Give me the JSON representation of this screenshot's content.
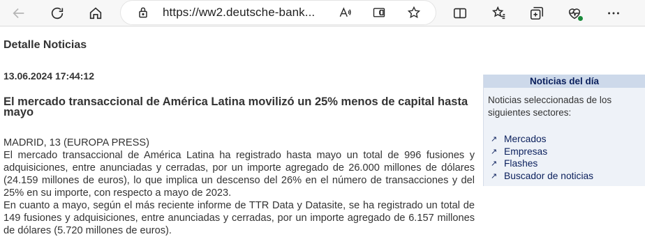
{
  "browser": {
    "url": "https://ww2.deutsche-bank..."
  },
  "page": {
    "heading": "Detalle Noticias",
    "timestamp": "13.06.2024 17:44:12",
    "headline": "El mercado transaccional de América Latina movilizó un 25% menos de capital hasta mayo",
    "dateline": "MADRID, 13 (EUROPA PRESS)",
    "paragraphs": [
      "El mercado transaccional de América Latina ha registrado hasta mayo un total de 996 fusiones y adquisiciones, entre anunciadas y cerradas, por un importe agregado de 26.000 millones de dólares (24.159 millones de euros), lo que implica un descenso del 26% en el número de transacciones y del 25% en su importe, con respecto a mayo de 2023.",
      "En cuanto a mayo, según el más reciente informe de TTR Data y Datasite, se ha registrado un total de 149 fusiones y adquisiciones, entre anunciadas y cerradas, por un importe agregado de 6.157 millones de dólares (5.720 millones de euros)."
    ]
  },
  "sidebar": {
    "title": "Noticias del día",
    "description": "Noticias seleccionadas de los siguientes sectores:",
    "links": [
      "Mercados",
      "Empresas",
      "Flashes",
      "Buscador de noticias"
    ]
  },
  "colors": {
    "sidebar_title_bg": "#cdd9ea",
    "sidebar_bg": "#eef2f8",
    "link": "#0a1f5c"
  }
}
